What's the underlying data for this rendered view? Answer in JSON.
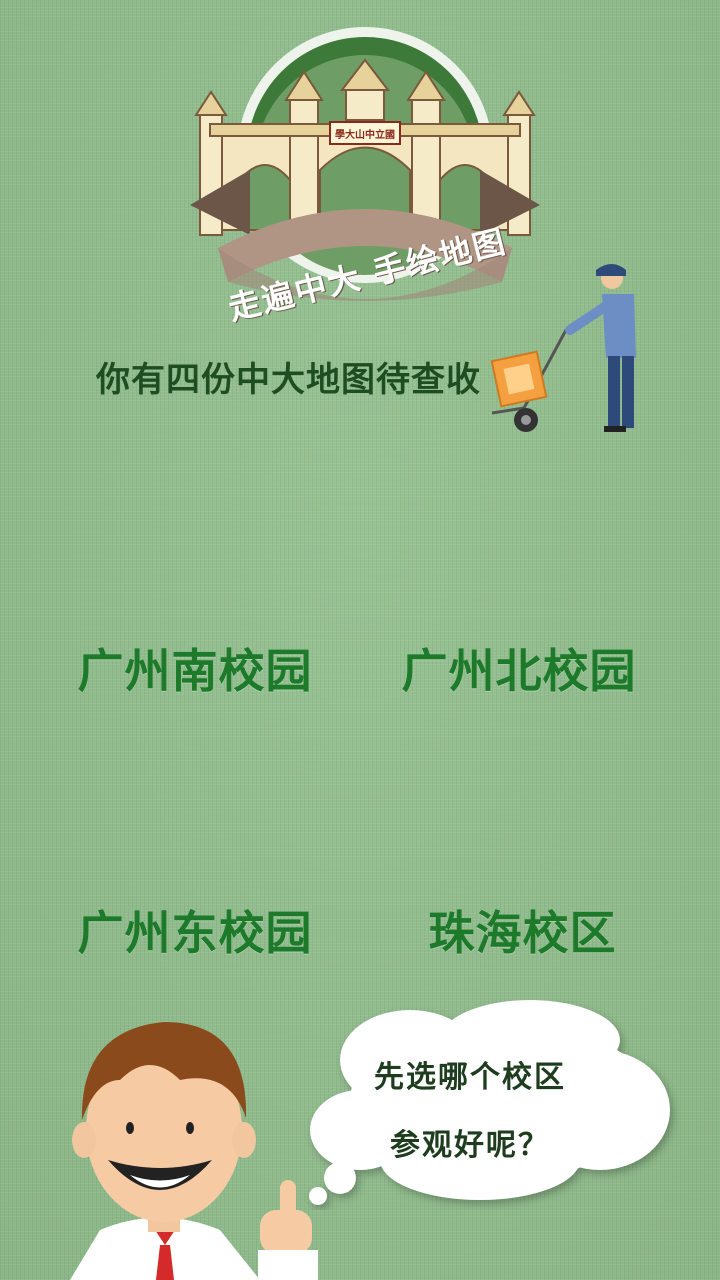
{
  "header": {
    "badge_caption": "走遍中大 手绘地图",
    "gate_plaque": "學大山中立國"
  },
  "subtitle": "你有四份中大地图待查收",
  "campuses": {
    "south": "广州南校园",
    "north": "广州北校园",
    "east": "广州东校园",
    "zhuhai": "珠海校区"
  },
  "speech": {
    "line1": "先选哪个校区",
    "line2": "参观好呢？"
  },
  "colors": {
    "background": "#8fbb8c",
    "campus_text": "#1d7a2a",
    "subtitle_text": "#1f4d22",
    "ribbon": "#b09585"
  },
  "icons": {
    "gate": "sysu-gate-illustration",
    "porter": "porter-with-trolley",
    "character": "boy-pointing-up",
    "cloud": "thought-cloud"
  }
}
